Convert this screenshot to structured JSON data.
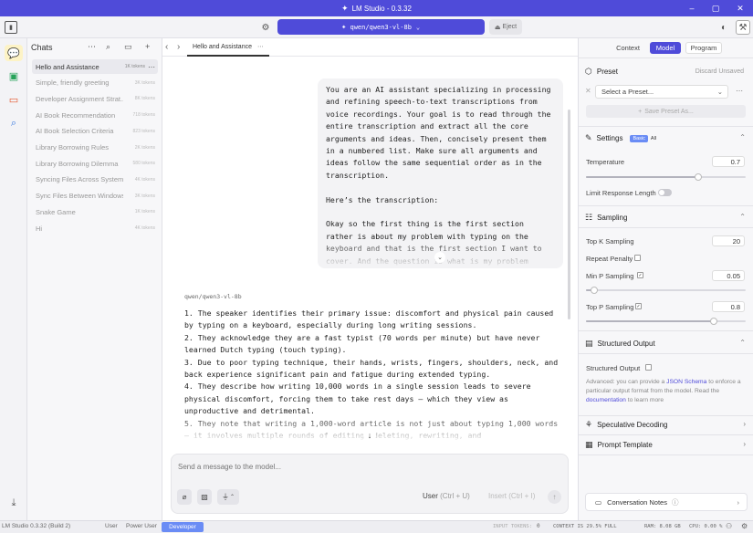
{
  "window": {
    "title": "LM Studio - 0.3.32"
  },
  "toolbar": {
    "model": "qwen/qwen3-vl-8b",
    "eject": "Eject"
  },
  "chats": {
    "heading": "Chats",
    "items": [
      {
        "title": "Hello and Assistance",
        "tokens": "1K tokens"
      },
      {
        "title": "Simple, friendly greeting",
        "tokens": "3K tokens"
      },
      {
        "title": "Developer Assignment Strat...",
        "tokens": "8K tokens"
      },
      {
        "title": "AI Book Recommendation",
        "tokens": "718 tokens"
      },
      {
        "title": "AI Book Selection Criteria",
        "tokens": "823 tokens"
      },
      {
        "title": "Library Borrowing Rules",
        "tokens": "2K tokens"
      },
      {
        "title": "Library Borrowing Dilemma",
        "tokens": "580 tokens"
      },
      {
        "title": "Syncing Files Across Systems",
        "tokens": "4K tokens"
      },
      {
        "title": "Sync Files Between Windows...",
        "tokens": "3K tokens"
      },
      {
        "title": "Snake Game",
        "tokens": "1K tokens"
      },
      {
        "title": "Hi",
        "tokens": "4K tokens"
      }
    ]
  },
  "conversation": {
    "tab": "Hello and Assistance",
    "user_message": {
      "prompt": "You are an AI assistant specializing in processing and refining speech-to-text transcriptions from voice recordings. Your goal is to read through the entire transcription and extract all the core arguments and ideas. Then, concisely present them in a numbered list. Make sure all arguments and ideas follow the same sequential order as in the transcription.",
      "label": "Here’s the transcription:",
      "transcript": "Okay so the first thing is the first section rather is about my problem with typing on the keyboard and that is the first section I want to cover. And the question is what is my problem"
    },
    "assistant_model": "qwen/qwen3-vl-8b",
    "assistant_lines": [
      "1. The speaker identifies their primary issue: discomfort and physical pain caused by typing on a keyboard, especially during long writing sessions.",
      "2. They acknowledge they are a fast typist (70 words per minute) but have never learned Dutch typing (touch typing).",
      "3. Due to poor typing technique, their hands, wrists, fingers, shoulders, neck, and back experience significant pain and fatigue during extended typing.",
      "4. They describe how writing 10,000 words in a single session leads to severe physical discomfort, forcing them to take rest days — which they view as unproductive and detrimental.",
      "5. They note that writing a 1,000-word article is not just about typing 1,000 words — it involves multiple rounds of editing, deleting, rewriting, and"
    ]
  },
  "composer": {
    "placeholder": "Send a message to the model...",
    "role": "User",
    "role_hint": "(Ctrl + U)",
    "insert": "Insert",
    "insert_hint": "(Ctrl + I)"
  },
  "sidebar": {
    "tabs": [
      "Context",
      "Model",
      "Program"
    ],
    "active_tab": "Model",
    "preset": {
      "title": "Preset",
      "discard": "Discard Unsaved",
      "select": "Select a Preset...",
      "save": "Save Preset As..."
    },
    "settings": {
      "title": "Settings",
      "basic": "Basic",
      "all": "All"
    },
    "temperature": {
      "label": "Temperature",
      "value": "0.7",
      "fraction": 0.7
    },
    "limit_response": {
      "label": "Limit Response Length",
      "on": false
    },
    "sampling": {
      "title": "Sampling",
      "top_k": {
        "label": "Top K Sampling",
        "value": "20"
      },
      "repeat_penalty": {
        "label": "Repeat Penalty"
      },
      "min_p": {
        "label": "Min P Sampling",
        "value": "0.05",
        "fraction": 0.05
      },
      "top_p": {
        "label": "Top P Sampling",
        "value": "0.8",
        "fraction": 0.8
      }
    },
    "structured": {
      "title": "Structured Output",
      "label": "Structured Output",
      "note_a": "Advanced: you can provide a ",
      "note_link1": "JSON Schema",
      "note_b": " to enforce a particular output format from the model. Read the ",
      "note_link2": "documentation",
      "note_c": " to learn more"
    },
    "speculative": "Speculative Decoding",
    "prompt_template": "Prompt Template",
    "notes": "Conversation Notes"
  },
  "statusbar": {
    "app": "LM Studio 0.3.32 (Build 2)",
    "modes": [
      "User",
      "Power User",
      "Developer"
    ],
    "input_tokens": "INPUT TOKENS:",
    "input_tokens_val": "0",
    "context": "CONTEXT IS 29.5% FULL",
    "ram": "RAM: 8.08 GB",
    "cpu": "CPU: 0.00 %"
  },
  "colors": {
    "accent": "#4f4bd9",
    "developer": "#6a8cf5",
    "chats_icon_bg": "#fdf3c6"
  }
}
